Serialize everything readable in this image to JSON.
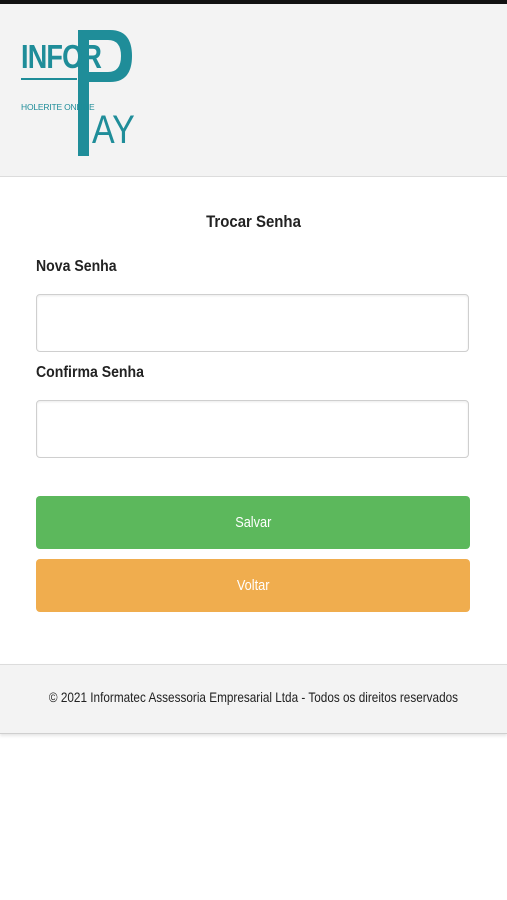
{
  "logo": {
    "brand_left": "INFOR",
    "brand_right_p": "P",
    "brand_right_rest": "AY",
    "tagline": "HOLERITE ONLINE",
    "color": "#1f8d99"
  },
  "form": {
    "title": "Trocar Senha",
    "new_password_label": "Nova Senha",
    "new_password_value": "",
    "confirm_password_label": "Confirma Senha",
    "confirm_password_value": ""
  },
  "buttons": {
    "save_label": "Salvar",
    "save_color": "#5cb85c",
    "back_label": "Voltar",
    "back_color": "#f0ad4e"
  },
  "footer": {
    "text": "© 2021 Informatec Assessoria Empresarial Ltda - Todos os direitos reservados"
  }
}
